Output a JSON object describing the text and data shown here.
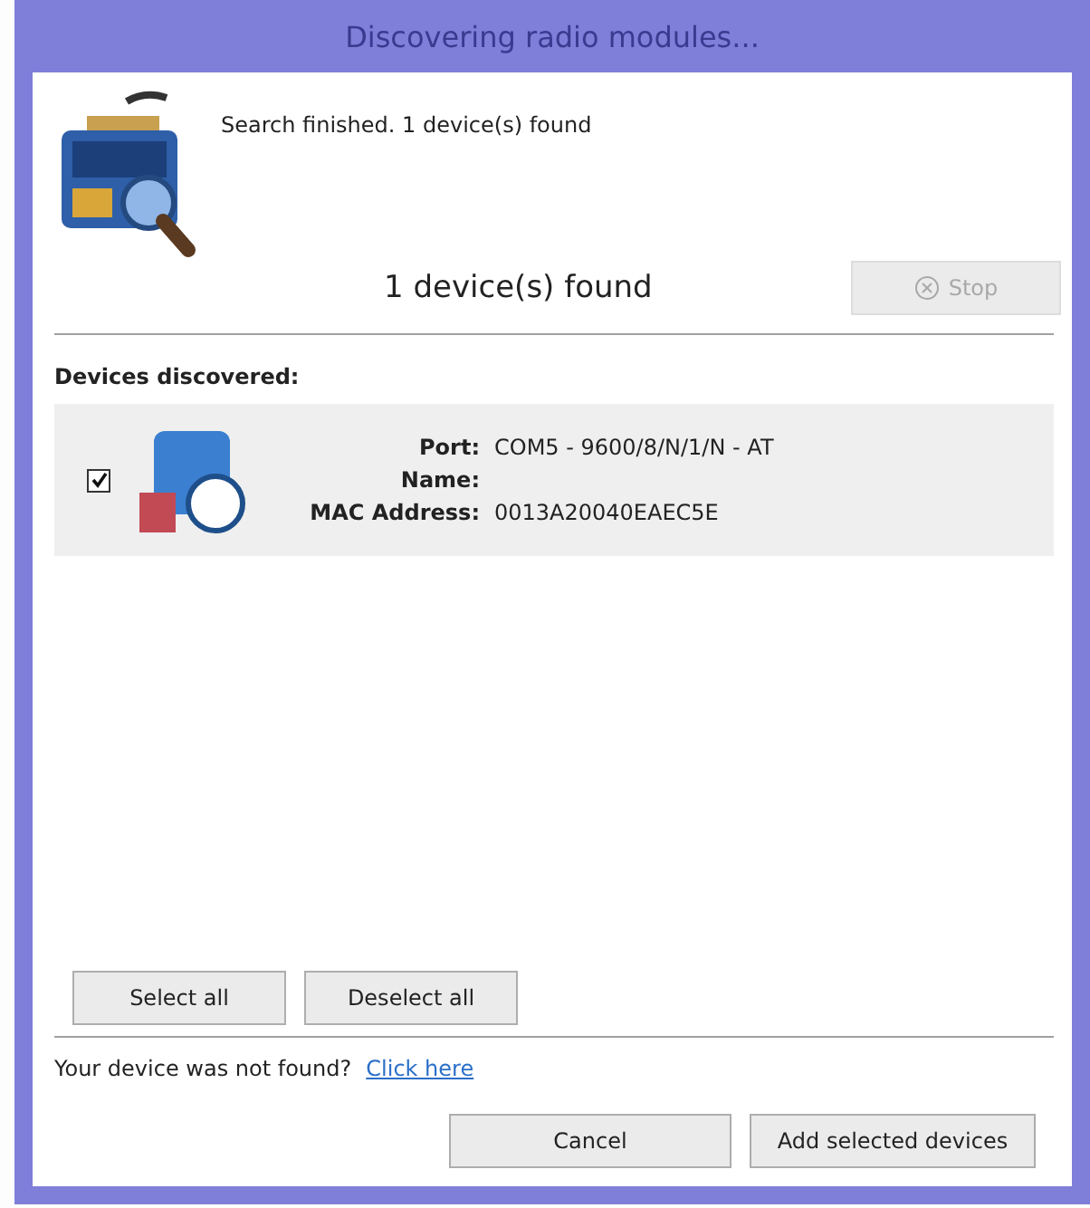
{
  "window": {
    "title": "Discovering radio modules..."
  },
  "status_message": "Search finished. 1 device(s) found",
  "found_count": "1 device(s) found",
  "stop_button": {
    "label": "Stop",
    "disabled": true
  },
  "devices_heading": "Devices discovered:",
  "devices": [
    {
      "checked": true,
      "fields": [
        {
          "label": "Port:",
          "value": "COM5 - 9600/8/N/1/N - AT"
        },
        {
          "label": "Name:"
        },
        {
          "label": "MAC Address:",
          "value": "0013A20040EAEC5E"
        }
      ]
    }
  ],
  "selection_buttons": [
    "Select all",
    "Deselect all"
  ],
  "help": {
    "text": "Your device was not found?",
    "link": "Click here"
  },
  "buttons": [
    "Cancel",
    "Add selected devices"
  ]
}
